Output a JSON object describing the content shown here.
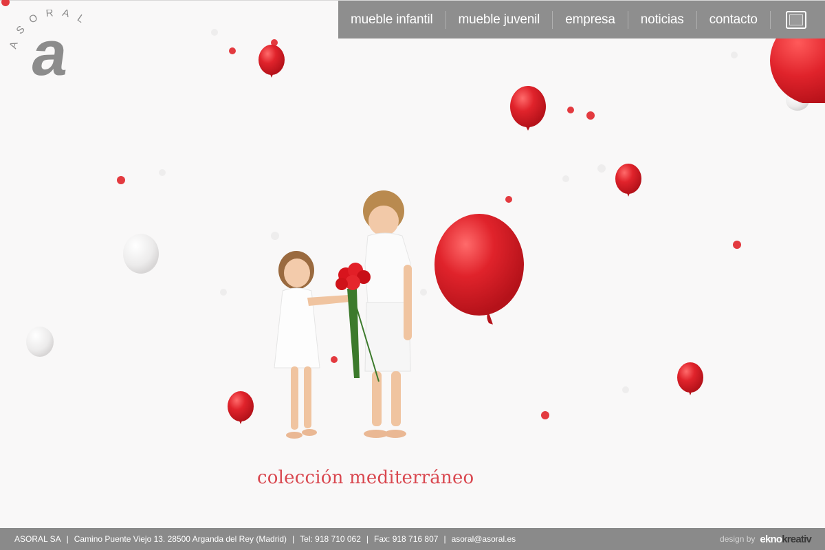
{
  "logo": {
    "ring_text": "ASORAL",
    "letter": "a"
  },
  "nav": {
    "items": [
      {
        "label": "mueble infantil"
      },
      {
        "label": "mueble juvenil"
      },
      {
        "label": "empresa"
      },
      {
        "label": "noticias"
      },
      {
        "label": "contacto"
      }
    ],
    "expand_icon": "fullscreen-icon"
  },
  "hero": {
    "caption": "colección mediterráneo",
    "accent_color": "#d9474f",
    "balloon_color": "#e0232b"
  },
  "footer": {
    "company": "ASORAL SA",
    "address": "Camino Puente Viejo 13. 28500 Arganda del Rey (Madrid)",
    "phone": "Tel: 918 710 062",
    "fax": "Fax: 918 716 807",
    "email": "asoral@asoral.es",
    "credit_prefix": "design by",
    "credit_brand_a": "ekno",
    "credit_brand_b": "kreativ"
  }
}
